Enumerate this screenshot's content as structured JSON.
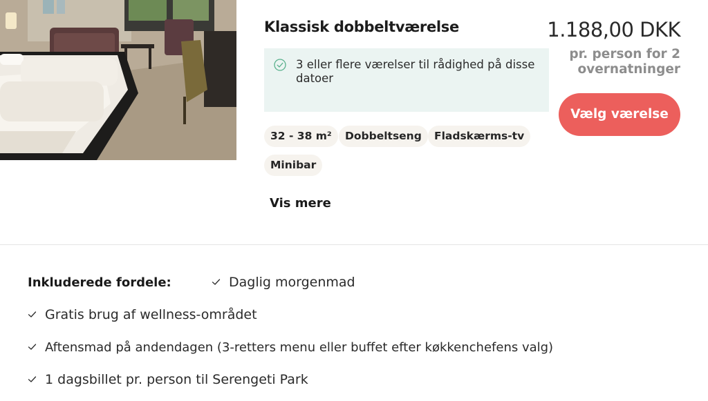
{
  "room": {
    "title": "Klassisk dobbeltværelse",
    "availability_text": "3 eller flere værelser til rådighed på disse datoer",
    "tags": [
      "32 - 38 m²",
      "Dobbeltseng",
      "Fladskærms-tv",
      "Minibar"
    ],
    "more_label": "Vis mere"
  },
  "pricing": {
    "price": "1.188,00 DKK",
    "per_person": "pr. person for 2 overnatninger",
    "select_label": "Vælg værelse"
  },
  "benefits": {
    "title": "Inkluderede fordele:",
    "items": [
      "Daglig morgenmad",
      "Gratis brug af wellness-området",
      "Aftensmad på andendagen (3-retters menu eller buffet efter køkkenchefens valg)",
      "1 dagsbillet pr. person til Serengeti Park"
    ]
  },
  "colors": {
    "accent_button": "#ec5f5c",
    "availability_bg": "#ebf4f2",
    "check_green": "#58b08c",
    "tag_bg": "#f6f3ee"
  },
  "icons": {
    "availability": "check-circle-icon",
    "benefit": "checkmark-icon"
  }
}
